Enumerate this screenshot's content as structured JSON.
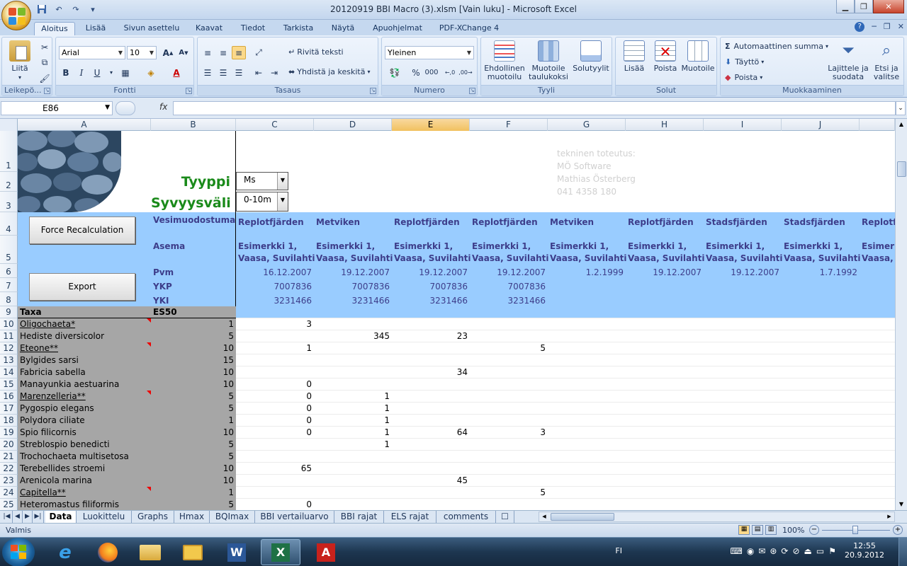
{
  "window": {
    "title": "20120919 BBI Macro (3).xlsm  [Vain luku] - Microsoft Excel"
  },
  "ribbon_tabs": [
    "Aloitus",
    "Lisää",
    "Sivun asettelu",
    "Kaavat",
    "Tiedot",
    "Tarkista",
    "Näytä",
    "Apuohjelmat",
    "PDF-XChange 4"
  ],
  "ribbon": {
    "clipboard": {
      "paste": "Liitä",
      "label": "Leikepö..."
    },
    "font": {
      "name": "Arial",
      "size": "10",
      "label": "Fontti"
    },
    "alignment": {
      "wrap_text": "Rivitä teksti",
      "merge_center": "Yhdistä ja keskitä",
      "label": "Tasaus"
    },
    "number": {
      "format": "Yleinen",
      "label": "Numero"
    },
    "styles": {
      "conditional": "Ehdollinen muotoilu",
      "format_table": "Muotoile taulukoksi",
      "cell_styles": "Solutyylit",
      "label": "Tyyli"
    },
    "cells": {
      "insert": "Lisää",
      "delete": "Poista",
      "format": "Muotoile",
      "label": "Solut"
    },
    "editing": {
      "autosum": "Automaattinen summa",
      "fill": "Täyttö",
      "clear": "Poista",
      "sort_filter": "Lajittele ja suodata",
      "find_select": "Etsi ja valitse",
      "label": "Muokkaaminen"
    }
  },
  "formula_bar": {
    "name_box": "E86",
    "fx": "fx",
    "formula": ""
  },
  "columns": [
    "A",
    "B",
    "C",
    "D",
    "E",
    "F",
    "G",
    "H",
    "I",
    "J"
  ],
  "selected_column": "E",
  "header_area": {
    "tyyppi_label": "Tyyppi",
    "tyyppi_value": "Ms",
    "syvyys_label": "Syvyysväli",
    "syvyys_value": "0-10m",
    "credit_lines": [
      "tekninen toteutus:",
      "MÖ Software",
      "Mathias Österberg",
      "041 4358 180"
    ],
    "force_button": "Force Recalculation",
    "export_button": "Export",
    "row_labels": {
      "vesimuodostuma": "Vesimuodostuma",
      "asema": "Asema",
      "pvm": "Pvm",
      "ykp": "YKP",
      "yki": "YKI"
    }
  },
  "stations": [
    {
      "vesimuodostuma": "Replotfjärden",
      "asema1": "Esimerkki 1,",
      "asema2": "Vaasa, Suvilahti",
      "pvm": "16.12.2007",
      "ykp": "7007836",
      "yki": "3231466"
    },
    {
      "vesimuodostuma": "Metviken",
      "asema1": "Esimerkki 1,",
      "asema2": "Vaasa, Suvilahti",
      "pvm": "19.12.2007",
      "ykp": "7007836",
      "yki": "3231466"
    },
    {
      "vesimuodostuma": "Replotfjärden",
      "asema1": "Esimerkki 1,",
      "asema2": "Vaasa, Suvilahti",
      "pvm": "19.12.2007",
      "ykp": "7007836",
      "yki": "3231466"
    },
    {
      "vesimuodostuma": "Replotfjärden",
      "asema1": "Esimerkki 1,",
      "asema2": "Vaasa, Suvilahti",
      "pvm": "19.12.2007",
      "ykp": "7007836",
      "yki": "3231466"
    },
    {
      "vesimuodostuma": "Metviken",
      "asema1": "Esimerkki 1,",
      "asema2": "Vaasa, Suvilahti",
      "pvm": "1.2.1999",
      "ykp": "",
      "yki": ""
    },
    {
      "vesimuodostuma": "Replotfjärden",
      "asema1": "Esimerkki 1,",
      "asema2": "Vaasa, Suvilahti",
      "pvm": "19.12.2007",
      "ykp": "",
      "yki": ""
    },
    {
      "vesimuodostuma": "Stadsfjärden",
      "asema1": "Esimerkki 1,",
      "asema2": "Vaasa, Suvilahti",
      "pvm": "19.12.2007",
      "ykp": "",
      "yki": ""
    },
    {
      "vesimuodostuma": "Stadsfjärden",
      "asema1": "Esimerkki 1,",
      "asema2": "Vaasa, Suvilahti",
      "pvm": "1.7.1992",
      "ykp": "",
      "yki": ""
    },
    {
      "vesimuodostuma": "Replotf",
      "asema1": "Esimerk",
      "asema2": "Vaasa,",
      "pvm": "1",
      "ykp": "",
      "yki": ""
    }
  ],
  "table_header": {
    "taxa": "Taxa",
    "es50": "ES50"
  },
  "taxa": [
    {
      "row": "10",
      "name": "Oligochaeta*",
      "es50": "1",
      "link": true,
      "comment": true,
      "c": "3",
      "d": "",
      "e": "",
      "f": ""
    },
    {
      "row": "11",
      "name": "Hediste diversicolor",
      "es50": "5",
      "link": false,
      "comment": false,
      "c": "",
      "d": "345",
      "e": "23",
      "f": ""
    },
    {
      "row": "12",
      "name": "Eteone**",
      "es50": "10",
      "link": true,
      "comment": true,
      "c": "1",
      "d": "",
      "e": "",
      "f": "5"
    },
    {
      "row": "13",
      "name": "Bylgides sarsi",
      "es50": "15",
      "link": false,
      "comment": false,
      "c": "",
      "d": "",
      "e": "",
      "f": ""
    },
    {
      "row": "14",
      "name": "Fabricia sabella",
      "es50": "10",
      "link": false,
      "comment": false,
      "c": "",
      "d": "",
      "e": "34",
      "f": ""
    },
    {
      "row": "15",
      "name": "Manayunkia aestuarina",
      "es50": "10",
      "link": false,
      "comment": false,
      "c": "0",
      "d": "",
      "e": "",
      "f": ""
    },
    {
      "row": "16",
      "name": "Marenzelleria**",
      "es50": "5",
      "link": true,
      "comment": true,
      "c": "0",
      "d": "1",
      "e": "",
      "f": ""
    },
    {
      "row": "17",
      "name": "Pygospio elegans",
      "es50": "5",
      "link": false,
      "comment": false,
      "c": "0",
      "d": "1",
      "e": "",
      "f": ""
    },
    {
      "row": "18",
      "name": "Polydora ciliate",
      "es50": "1",
      "link": false,
      "comment": false,
      "c": "0",
      "d": "1",
      "e": "",
      "f": ""
    },
    {
      "row": "19",
      "name": "Spio filicornis",
      "es50": "10",
      "link": false,
      "comment": false,
      "c": "0",
      "d": "1",
      "e": "64",
      "f": "3"
    },
    {
      "row": "20",
      "name": "Streblospio benedicti",
      "es50": "5",
      "link": false,
      "comment": false,
      "c": "",
      "d": "1",
      "e": "",
      "f": ""
    },
    {
      "row": "21",
      "name": "Trochochaeta multisetosa",
      "es50": "5",
      "link": false,
      "comment": false,
      "c": "",
      "d": "",
      "e": "",
      "f": ""
    },
    {
      "row": "22",
      "name": "Terebellides stroemi",
      "es50": "10",
      "link": false,
      "comment": false,
      "c": "65",
      "d": "",
      "e": "",
      "f": ""
    },
    {
      "row": "23",
      "name": "Arenicola marina",
      "es50": "10",
      "link": false,
      "comment": false,
      "c": "",
      "d": "",
      "e": "45",
      "f": ""
    },
    {
      "row": "24",
      "name": "Capitella**",
      "es50": "1",
      "link": true,
      "comment": true,
      "c": "",
      "d": "",
      "e": "",
      "f": "5"
    },
    {
      "row": "25",
      "name": "Heteromastus filiformis",
      "es50": "5",
      "link": false,
      "comment": false,
      "c": "0",
      "d": "",
      "e": "",
      "f": ""
    }
  ],
  "sheet_tabs": [
    "Data",
    "Luokittelu",
    "Graphs",
    "Hmax",
    "BQImax",
    "BBI vertailuarvo",
    "BBI rajat",
    "ELS rajat",
    "comments"
  ],
  "active_sheet": "Data",
  "status": {
    "ready": "Valmis",
    "zoom": "100%"
  },
  "taskbar": {
    "lang": "FI",
    "time": "12:55",
    "date": "20.9.2012"
  },
  "colors": {
    "header_blue": "#99ccff",
    "label_green": "#1a8a1a",
    "label_blue": "#3d3d8a",
    "gray": "#a6a6a6"
  }
}
